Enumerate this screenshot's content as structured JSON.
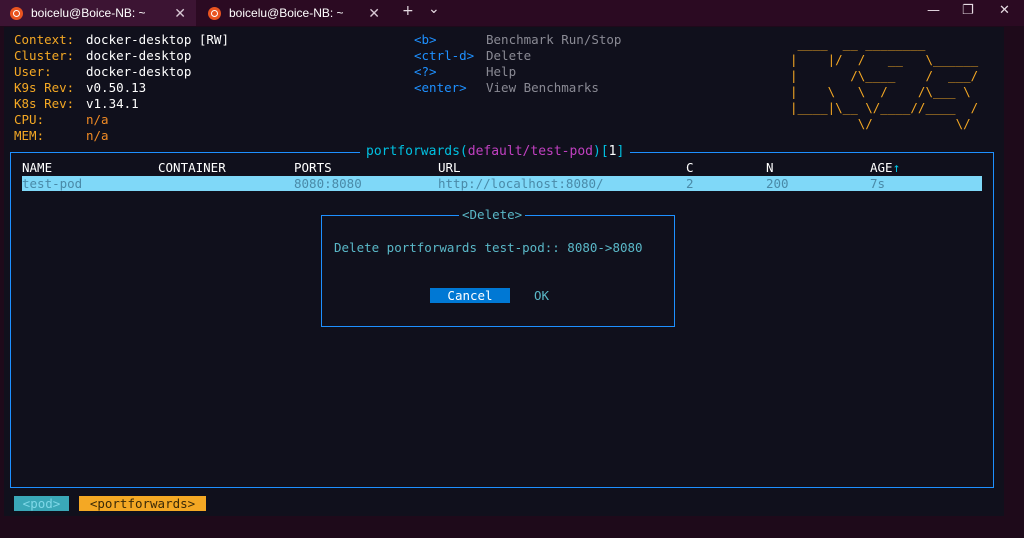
{
  "tabs": [
    {
      "title": "boicelu@Boice-NB: ~",
      "close": "✕"
    },
    {
      "title": "boicelu@Boice-NB: ~",
      "close": "✕"
    }
  ],
  "titlebar": {
    "new_tab": "+",
    "dropdown": "⌄",
    "minimize": "—",
    "maximize": "❐",
    "close": "✕"
  },
  "info": [
    {
      "label": "Context:",
      "value": "docker-desktop [RW]"
    },
    {
      "label": "Cluster:",
      "value": "docker-desktop"
    },
    {
      "label": "User:",
      "value": "docker-desktop"
    },
    {
      "label": "K9s Rev:",
      "value": "v0.50.13"
    },
    {
      "label": "K8s Rev:",
      "value": "v1.34.1"
    },
    {
      "label": "CPU:",
      "value": "n/a"
    },
    {
      "label": "MEM:",
      "value": "n/a"
    }
  ],
  "shortcuts": [
    {
      "key": "<b>",
      "action": "Benchmark Run/Stop"
    },
    {
      "key": "<ctrl-d>",
      "action": "Delete"
    },
    {
      "key": "<?>",
      "action": "Help"
    },
    {
      "key": "<enter>",
      "action": "View Benchmarks"
    }
  ],
  "logo": " ____  __ ________       \n|    |/  /   __   \\______\n|       /\\____    /  ___/\n|    \\   \\  /    /\\___ \\ \n|____|\\__ \\/____//____  /\n         \\/           \\/ ",
  "view": {
    "resource": "portforwards",
    "open_paren": "(",
    "scope": "default/test-pod",
    "close_paren": ")",
    "open_bracket": "[",
    "count": "1",
    "close_bracket": "]"
  },
  "table": {
    "columns": [
      "NAME",
      "CONTAINER",
      "PORTS",
      "URL",
      "C",
      "N",
      "AGE"
    ],
    "sort_arrow": "↑",
    "rows": [
      {
        "name": "test-pod",
        "container": "",
        "ports": "8080:8080",
        "url": "http://localhost:8080/",
        "c": "2",
        "n": "200",
        "age": "7s"
      }
    ]
  },
  "dialog": {
    "title": "<Delete>",
    "message": "Delete portforwards test-pod:: 8080->8080",
    "cancel": "Cancel",
    "ok": "OK"
  },
  "breadcrumbs": [
    "<pod>",
    "<portforwards>"
  ]
}
